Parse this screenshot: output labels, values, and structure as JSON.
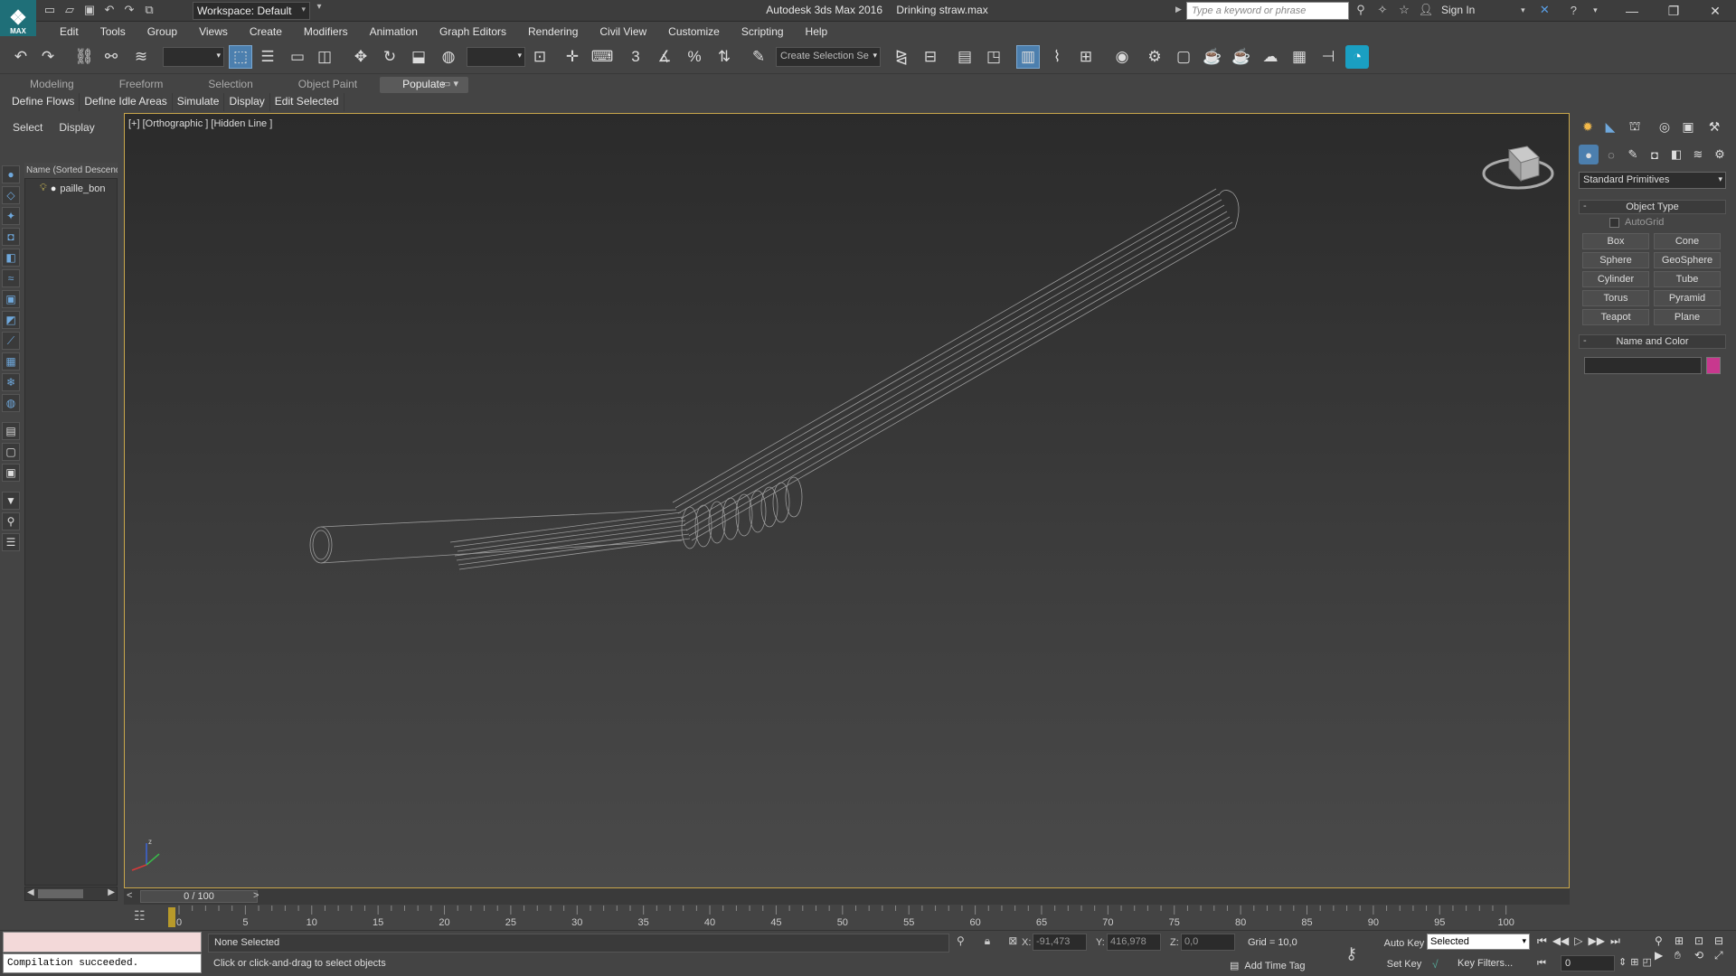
{
  "app": {
    "logo_text": "MAX",
    "title": "Autodesk 3ds Max 2016",
    "filename": "Drinking straw.max",
    "workspace": "Workspace: Default",
    "search_placeholder": "Type a keyword or phrase",
    "sign_in": "Sign In"
  },
  "menu": [
    "Edit",
    "Tools",
    "Group",
    "Views",
    "Create",
    "Modifiers",
    "Animation",
    "Graph Editors",
    "Rendering",
    "Civil View",
    "Customize",
    "Scripting",
    "Help"
  ],
  "toolbar": {
    "selection_set_placeholder": "Create Selection Se",
    "snap_3": "3",
    "snap_percent": "%"
  },
  "ribbon": {
    "tabs": [
      "Modeling",
      "Freeform",
      "Selection",
      "Object Paint",
      "Populate"
    ],
    "active_tab": "Populate",
    "panel_buttons": [
      "Define Flows",
      "Define Idle Areas",
      "Simulate",
      "Display",
      "Edit Selected"
    ]
  },
  "explorer": {
    "tabs": [
      "Select",
      "Display"
    ],
    "column_header": "Name (Sorted Descending)",
    "items": [
      "paille_bon"
    ]
  },
  "viewport": {
    "label": "[+] [Orthographic ] [Hidden Line ]",
    "axis_z": "z"
  },
  "command_panel": {
    "dropdown": "Standard Primitives",
    "object_type_title": "Object Type",
    "autogrid": "AutoGrid",
    "primitives": [
      "Box",
      "Cone",
      "Sphere",
      "GeoSphere",
      "Cylinder",
      "Tube",
      "Torus",
      "Pyramid",
      "Teapot",
      "Plane"
    ],
    "name_color_title": "Name and Color",
    "object_color": "#c8388e"
  },
  "timeline": {
    "frame_display": "0 / 100",
    "prev": "<",
    "next": ">",
    "ticks": [
      "0",
      "5",
      "10",
      "15",
      "20",
      "25",
      "30",
      "35",
      "40",
      "45",
      "50",
      "55",
      "60",
      "65",
      "70",
      "75",
      "80",
      "85",
      "90",
      "95",
      "100"
    ]
  },
  "status": {
    "maxscript_output": "Compilation succeeded.",
    "selection": "None Selected",
    "prompt": "Click or click-and-drag to select objects",
    "x_label": "X:",
    "x_value": "-91,473",
    "y_label": "Y:",
    "y_value": "416,978",
    "z_label": "Z:",
    "z_value": "0,0",
    "grid": "Grid = 10,0",
    "add_time_tag": "Add Time Tag",
    "auto_key": "Auto Key",
    "set_key": "Set Key",
    "key_mode": "Selected",
    "key_filters": "Key Filters...",
    "current_frame": "0"
  }
}
